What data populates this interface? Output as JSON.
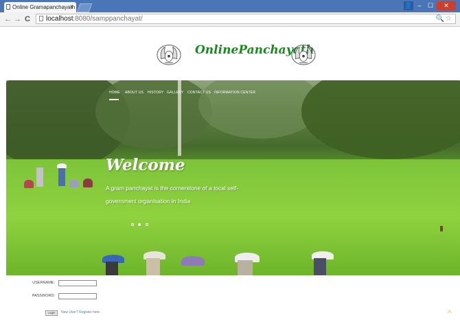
{
  "browser": {
    "tab_title": "Online Gramapanchayath",
    "tab_close": "×",
    "url_host": "localhost",
    "url_rest": ":8080/samppanchayat/",
    "back_glyph": "←",
    "forward_glyph": "→",
    "reload_glyph": "C",
    "zoom_glyph": "🔍",
    "star_glyph": "☆",
    "min_glyph": "–",
    "max_glyph": "☐",
    "close_glyph": "✕",
    "user_glyph": "👤"
  },
  "site": {
    "brand": "OnlinePanchayath",
    "nav": [
      "HOME",
      "ABOUT US",
      "HISTORY",
      "GALLERY",
      "CONTACT US",
      "INFORMATION CENTER"
    ],
    "hero_title": "Welcome",
    "hero_caption": "A gram panchayat is the cornerstone of a local self-government organisation in India",
    "slides": 3,
    "active_slide": 2
  },
  "login": {
    "username_label": "USERNAME:",
    "password_label": "PASSWORD:",
    "username_value": "",
    "password_value": "",
    "login_button": "Login",
    "register_link": "New User? Register here"
  },
  "colors": {
    "brand_green": "#178c1c",
    "tab_bar": "#4a76b8",
    "link_blue": "#4a7fc1"
  }
}
